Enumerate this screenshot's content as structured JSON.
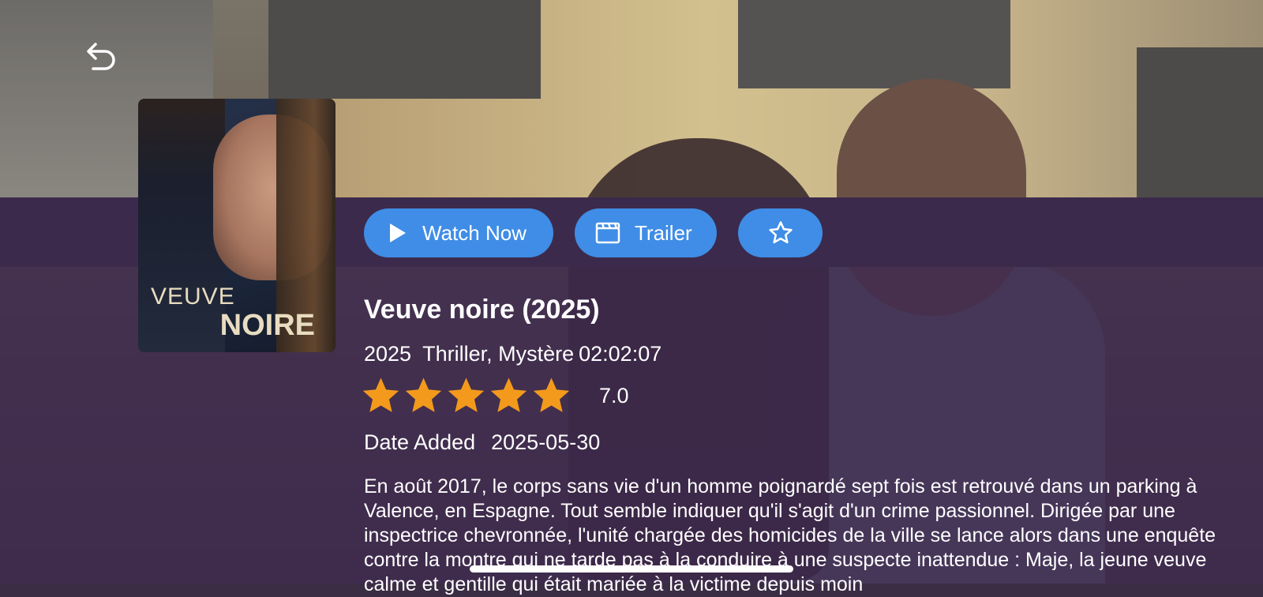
{
  "poster": {
    "line1": "VEUVE",
    "line2": "NOIRE"
  },
  "actions": {
    "watch_label": "Watch Now",
    "trailer_label": "Trailer",
    "favorite_icon": "star-outline-icon"
  },
  "movie": {
    "title": "Veuve noire (2025)",
    "year": "2025",
    "genres": "Thriller, Mystère",
    "duration": "02:02:07",
    "stars_total": 5,
    "stars_filled": 5,
    "rating": "7.0",
    "date_added_label": "Date Added",
    "date_added": "2025-05-30",
    "description": "En août 2017, le corps sans vie d'un homme poignardé sept fois est retrouvé dans un parking à Valence, en Espagne. Tout semble indiquer qu'il s'agit d'un crime passionnel. Dirigée par une inspectrice chevronnée, l'unité chargée des homicides de la ville se lance alors dans une enquête contre la montre qui ne tarde pas à la conduire à une suspecte inattendue : Maje, la jeune veuve calme et gentille qui était mariée à la victime depuis moin"
  },
  "colors": {
    "accent": "#3f8de6",
    "star": "#f39a1c",
    "band": "#3c2a4c"
  }
}
